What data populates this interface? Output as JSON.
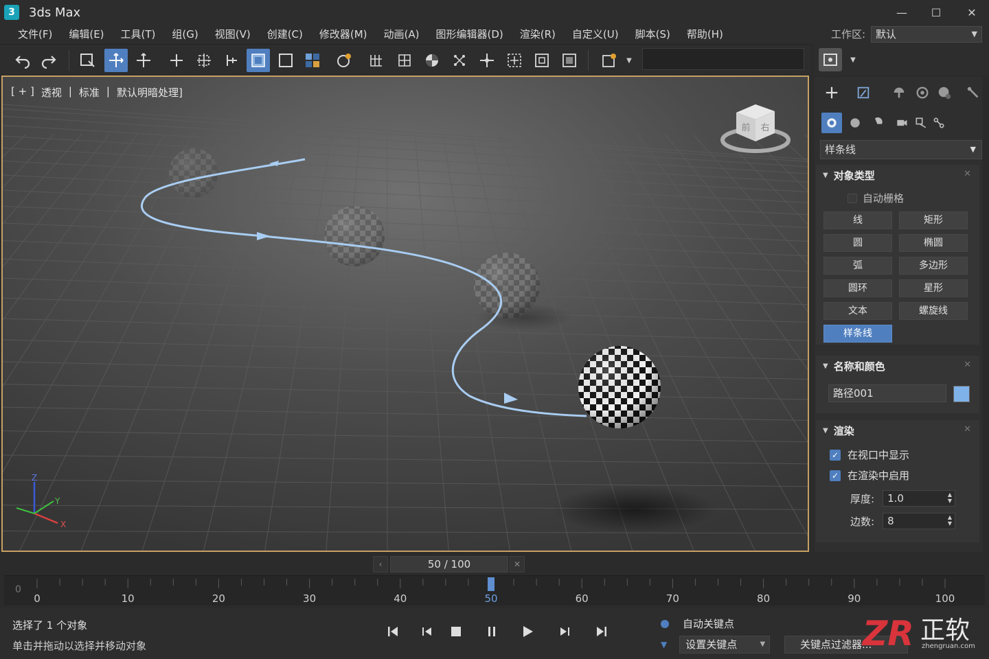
{
  "app": {
    "title": "3ds Max",
    "logo_text": "3"
  },
  "window_controls": {
    "minimize": "—",
    "maximize": "☐",
    "close": "✕"
  },
  "menu": [
    "文件(F)",
    "编辑(E)",
    "工具(T)",
    "组(G)",
    "视图(V)",
    "创建(C)",
    "修改器(M)",
    "动画(A)",
    "图形编辑器(D)",
    "渲染(R)",
    "自定义(U)",
    "脚本(S)",
    "帮助(H)"
  ],
  "workspace": {
    "label": "工作区:",
    "value": "默认"
  },
  "viewport": {
    "label_parts": [
      "[ + ]",
      "透视",
      "|",
      "标准",
      "|",
      "默认明暗处理]"
    ],
    "viewcube": {
      "front": "前",
      "right": "右"
    },
    "axes": {
      "x": "X",
      "y": "Y",
      "z": "Z"
    }
  },
  "command_panel": {
    "category": "样条线",
    "object_type": {
      "title": "对象类型",
      "autogrid": "自动栅格",
      "buttons": [
        "线",
        "矩形",
        "圆",
        "椭圆",
        "弧",
        "多边形",
        "圆环",
        "星形",
        "文本",
        "螺旋线",
        "样条线"
      ],
      "active": "样条线"
    },
    "name_color": {
      "title": "名称和颜色",
      "name": "路径001",
      "color": "#7fb2e8"
    },
    "render": {
      "title": "渲染",
      "show_in_viewport": "在视口中显示",
      "enable_in_render": "在渲染中启用",
      "thickness_label": "厚度:",
      "thickness": "1.0",
      "sides_label": "边数:",
      "sides": "8"
    }
  },
  "time": {
    "display": "50 / 100",
    "current_frame": 50,
    "range": [
      0,
      100
    ],
    "ruler_labels": [
      "0",
      "10",
      "20",
      "30",
      "40",
      "50",
      "60",
      "70",
      "80",
      "90",
      "100"
    ],
    "left_marker": "0"
  },
  "status": {
    "selection": "选择了 1 个对象",
    "hint": "单击并拖动以选择并移动对象",
    "auto_key": "自动关键点",
    "set_key": "设置关键点",
    "key_filter": "关键点过滤器..."
  },
  "watermark": {
    "logo": "ZR",
    "name": "正软",
    "url": "zhengruan.com"
  },
  "colors": {
    "accent": "#4f7fbf",
    "viewport_border": "#c8a165",
    "spline": "#a9cdf2"
  }
}
